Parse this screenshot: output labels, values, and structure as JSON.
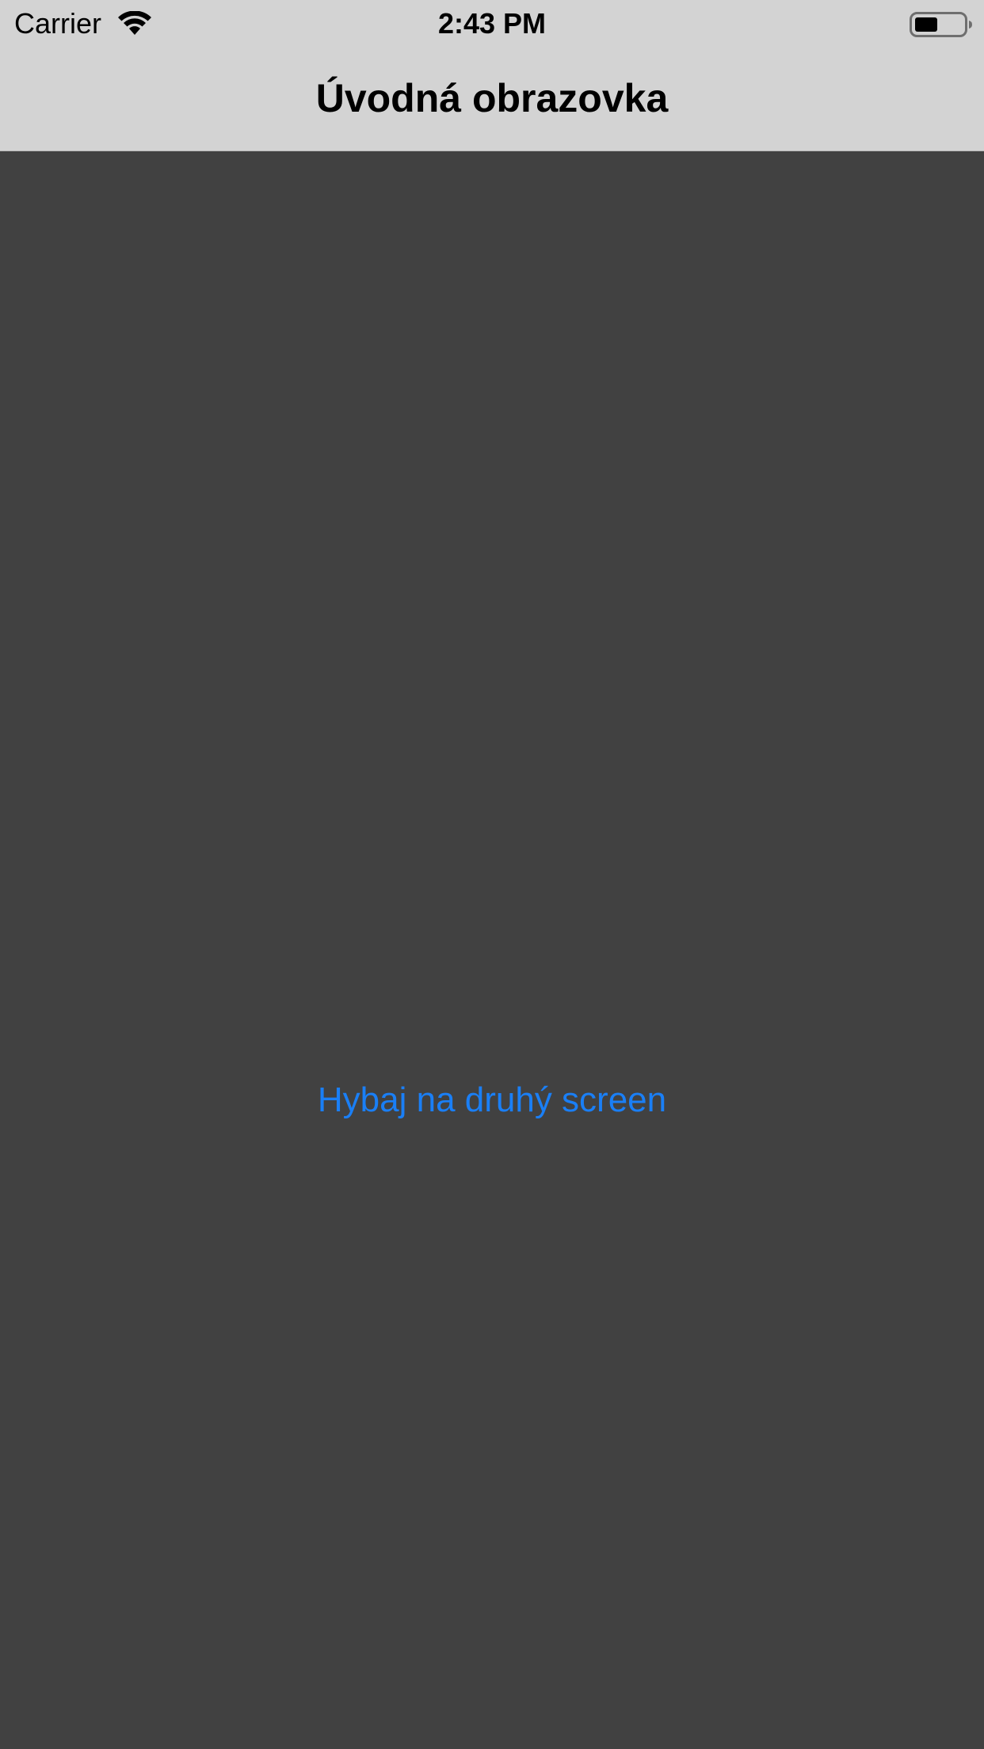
{
  "status_bar": {
    "carrier": "Carrier",
    "time": "2:43 PM",
    "wifi_icon": "wifi-icon",
    "battery_icon": "battery-icon"
  },
  "nav_bar": {
    "title": "Úvodná obrazovka"
  },
  "main": {
    "next_button_label": "Hybaj na druhý screen"
  },
  "colors": {
    "nav_background": "#d3d3d3",
    "content_background": "#414141",
    "link": "#1a7ff6"
  }
}
